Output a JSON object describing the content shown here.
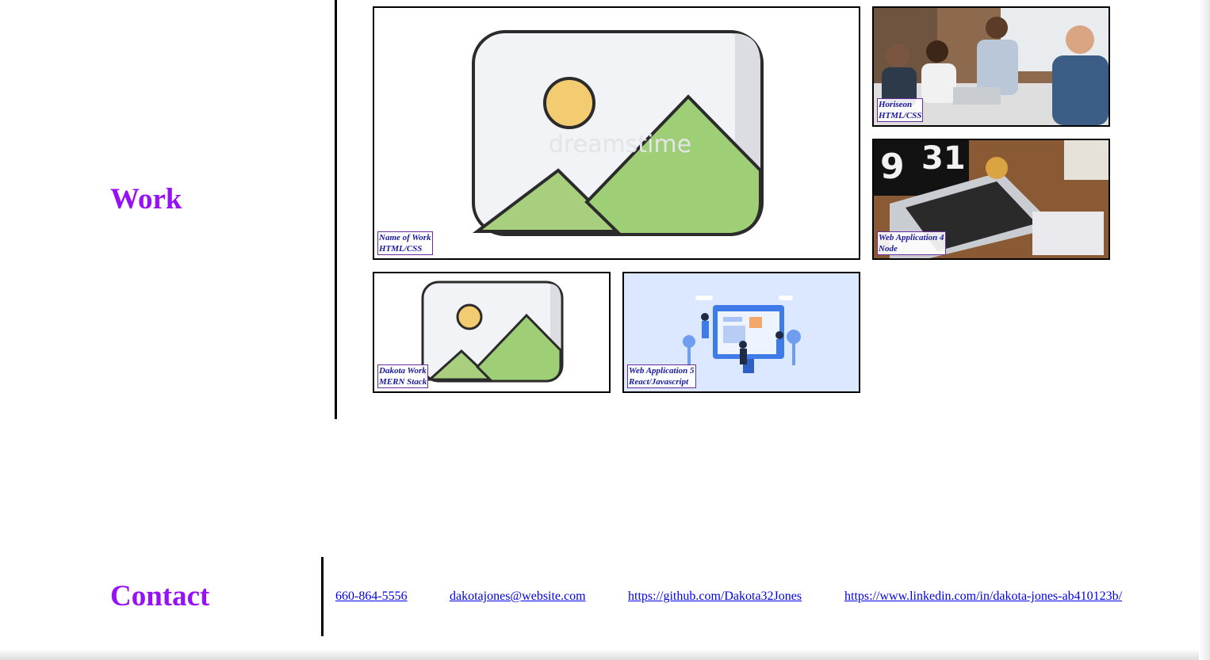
{
  "work": {
    "title": "Work",
    "projects": [
      {
        "name": "Name of Work",
        "tech": "HTML/CSS",
        "image": "placeholder-landscape-icon"
      },
      {
        "name": "Horiseon",
        "tech": "HTML/CSS",
        "image": "team-meeting-photo"
      },
      {
        "name": "Web Application 4",
        "tech": "Node",
        "image": "laptop-desk-photo"
      },
      {
        "name": "Dakota Work",
        "tech": "MERN Stack",
        "image": "placeholder-landscape-icon"
      },
      {
        "name": "Web Application 5",
        "tech": "React/Javascript",
        "image": "web-development-illustration"
      }
    ]
  },
  "contact": {
    "title": "Contact",
    "phone": "660-864-5556",
    "email": "dakotajones@website.com",
    "github": "https://github.com/Dakota32Jones",
    "linkedin": "https://www.linkedin.com/in/dakota-jones-ab410123b/"
  },
  "colors": {
    "heading": "#9611f5",
    "link": "#0000ee",
    "caption_border": "#6a2e9c"
  }
}
